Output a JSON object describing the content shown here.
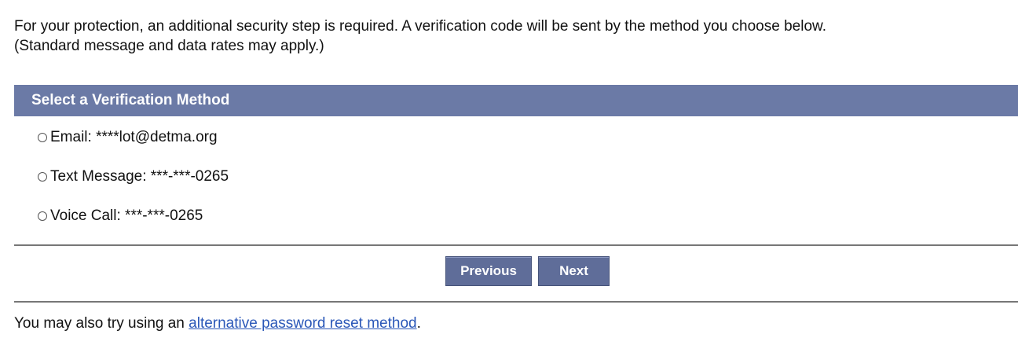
{
  "intro": {
    "line1": "For your protection, an additional security step is required. A verification code will be sent by the method you choose below.",
    "line2": "(Standard message and data rates may apply.)"
  },
  "panel": {
    "title": "Select a Verification Method",
    "options": [
      {
        "label": "Email: ****lot@detma.org",
        "selected": false
      },
      {
        "label": "Text Message: ***-***-0265",
        "selected": false
      },
      {
        "label": "Voice Call: ***-***-0265",
        "selected": false
      }
    ]
  },
  "buttons": {
    "previous": "Previous",
    "next": "Next"
  },
  "footer": {
    "prefix": "You may also try using an ",
    "link": "alternative password reset method",
    "suffix": "."
  },
  "colors": {
    "header_bg": "#6b7aa6",
    "button_bg": "#5f6d99",
    "link": "#2a57b8"
  }
}
